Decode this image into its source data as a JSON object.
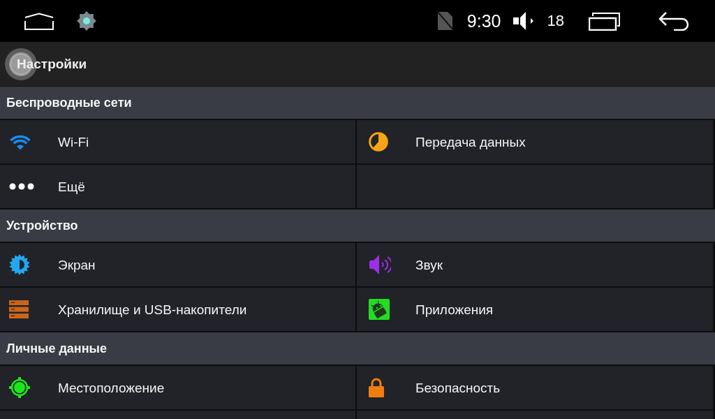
{
  "status_bar": {
    "time": "9:30",
    "volume": "18"
  },
  "title_bar": {
    "title": "Настройки"
  },
  "sections": [
    {
      "title": "Беспроводные сети",
      "items": [
        {
          "kind": "wifi",
          "label": "Wi-Fi"
        },
        {
          "kind": "data_usage",
          "label": "Передача данных"
        },
        {
          "kind": "more",
          "label": "Ещё"
        }
      ]
    },
    {
      "title": "Устройство",
      "items": [
        {
          "kind": "display",
          "label": "Экран"
        },
        {
          "kind": "sound",
          "label": "Звук"
        },
        {
          "kind": "storage",
          "label": "Хранилище и USB-накопители"
        },
        {
          "kind": "apps",
          "label": "Приложения"
        }
      ]
    },
    {
      "title": "Личные данные",
      "items": [
        {
          "kind": "location",
          "label": "Местоположение"
        },
        {
          "kind": "security",
          "label": "Безопасность"
        }
      ]
    }
  ]
}
